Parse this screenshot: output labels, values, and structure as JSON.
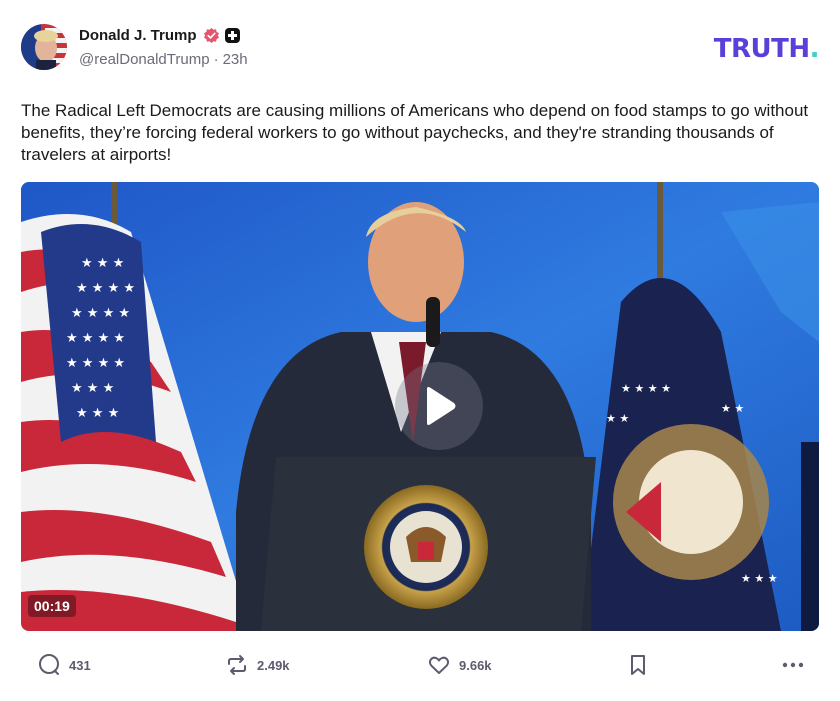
{
  "author": {
    "display_name": "Donald J. Trump",
    "handle": "@realDonaldTrump",
    "separator": "·",
    "time_ago": "23h",
    "avatar_icon": "avatar-image"
  },
  "brand": {
    "logo_text": "TRUTH",
    "logo_dot": ".",
    "logo_color": "#5a3fd9",
    "dot_color": "#3ed1c2"
  },
  "post": {
    "text": "The Radical Left Democrats are causing millions of Americans who depend on food stamps to go without benefits, they’re forcing federal workers to go without paychecks, and they're stranding thousands of travelers at airports!"
  },
  "video": {
    "duration": "00:19",
    "play_icon": "play-icon"
  },
  "actions": {
    "replies": "431",
    "retruths": "2.49k",
    "likes": "9.66k",
    "reply_icon": "comment-icon",
    "retruth_icon": "repost-icon",
    "like_icon": "heart-icon",
    "bookmark_icon": "bookmark-icon",
    "more_icon": "more-icon"
  }
}
